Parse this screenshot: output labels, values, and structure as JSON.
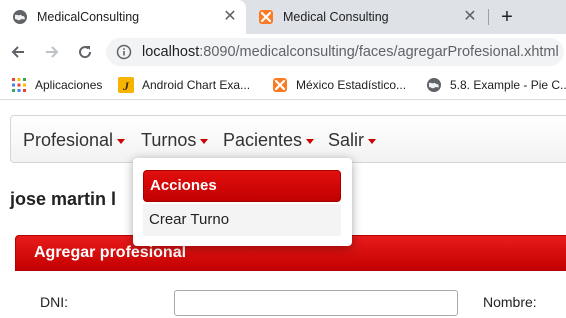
{
  "browser": {
    "tabs": [
      {
        "title": "MedicalConsulting",
        "icon": "globe-icon",
        "active": true
      },
      {
        "title": "Medical Consulting",
        "icon": "xampp-icon",
        "active": false
      }
    ],
    "close_glyph": "✕",
    "new_tab_glyph": "+",
    "url_host": "localhost",
    "url_rest": ":8090/medicalconsulting/faces/agregarProfesional.xhtml",
    "bookmarks": [
      {
        "label": "Aplicaciones",
        "icon": "apps-grid-icon"
      },
      {
        "label": "Android Chart Exa...",
        "icon": "j-icon"
      },
      {
        "label": "México Estadístico...",
        "icon": "xampp-icon"
      },
      {
        "label": "5.8. Example - Pie C...",
        "icon": "globe-icon"
      }
    ]
  },
  "menu": {
    "items": [
      "Profesional",
      "Turnos",
      "Pacientes",
      "Salir"
    ],
    "open": "Turnos"
  },
  "dropdown": {
    "header": "Acciones",
    "items": [
      "Crear Turno"
    ]
  },
  "user": {
    "name": "jose martin l"
  },
  "form": {
    "panel_title": "Agregar profesional",
    "fields": [
      {
        "label": "DNI:",
        "value": ""
      },
      {
        "label": "Nombre:",
        "value": ""
      }
    ]
  },
  "colors": {
    "accent": "#cc0000",
    "tab_strip": "#dee1e6",
    "omnibox": "#f1f3f4"
  }
}
